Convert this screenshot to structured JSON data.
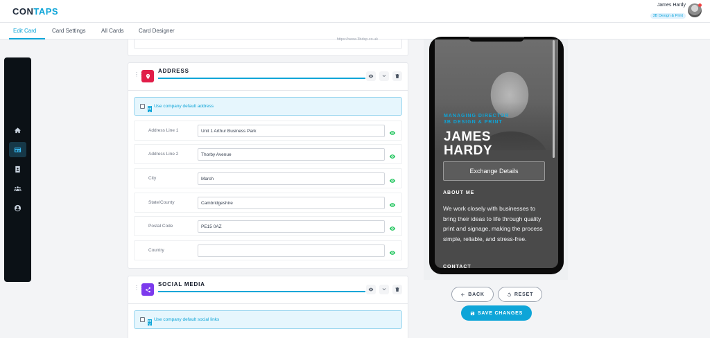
{
  "header": {
    "logo_left": "CON",
    "logo_accent": "TAPS",
    "user_name": "James Hardy",
    "user_company": "3B Design & Print"
  },
  "tabs": [
    {
      "label": "Edit Card"
    },
    {
      "label": "Card Settings"
    },
    {
      "label": "All Cards"
    },
    {
      "label": "Card Designer"
    }
  ],
  "sidebar": {
    "items": [
      {
        "icon": "home-icon"
      },
      {
        "icon": "card-icon",
        "active": true
      },
      {
        "icon": "contacts-book-icon"
      },
      {
        "icon": "team-icon"
      },
      {
        "icon": "user-circle-icon"
      }
    ]
  },
  "previous_section": {
    "url_text": "https://www.3bdsp.co.uk"
  },
  "address": {
    "title": "ADDRESS",
    "icon_color": "#e11d48",
    "default_label": "Use company default address",
    "fields": [
      {
        "label": "Address Line 1",
        "value": "Unit 1 Arthur Business Park"
      },
      {
        "label": "Address Line 2",
        "value": "Thorby Avenue"
      },
      {
        "label": "City",
        "value": "March"
      },
      {
        "label": "State/County",
        "value": "Cambridgeshire"
      },
      {
        "label": "Postal Code",
        "value": "PE15 0AZ"
      },
      {
        "label": "Country",
        "value": ""
      }
    ]
  },
  "social": {
    "title": "SOCIAL MEDIA",
    "icon_color": "#7c3aed",
    "default_label": "Use company default social links"
  },
  "preview": {
    "role_line1": "MANAGING DIRECTOR",
    "role_line2": "3B DESIGN & PRINT",
    "name_line1": "JAMES",
    "name_line2": "HARDY",
    "exchange_label": "Exchange Details",
    "about_heading": "ABOUT ME",
    "about_text": "We work closely with businesses to bring their ideas to life through quality print and signage, making the process simple, reliable, and stress-free.",
    "contact_heading": "CONTACT"
  },
  "actions": {
    "back_label": "BACK",
    "reset_label": "RESET",
    "save_label": "SAVE CHANGES"
  },
  "colors": {
    "accent": "#0ea5d8",
    "visible_green": "#22c55e",
    "sidebar_bg": "#0b1116"
  }
}
